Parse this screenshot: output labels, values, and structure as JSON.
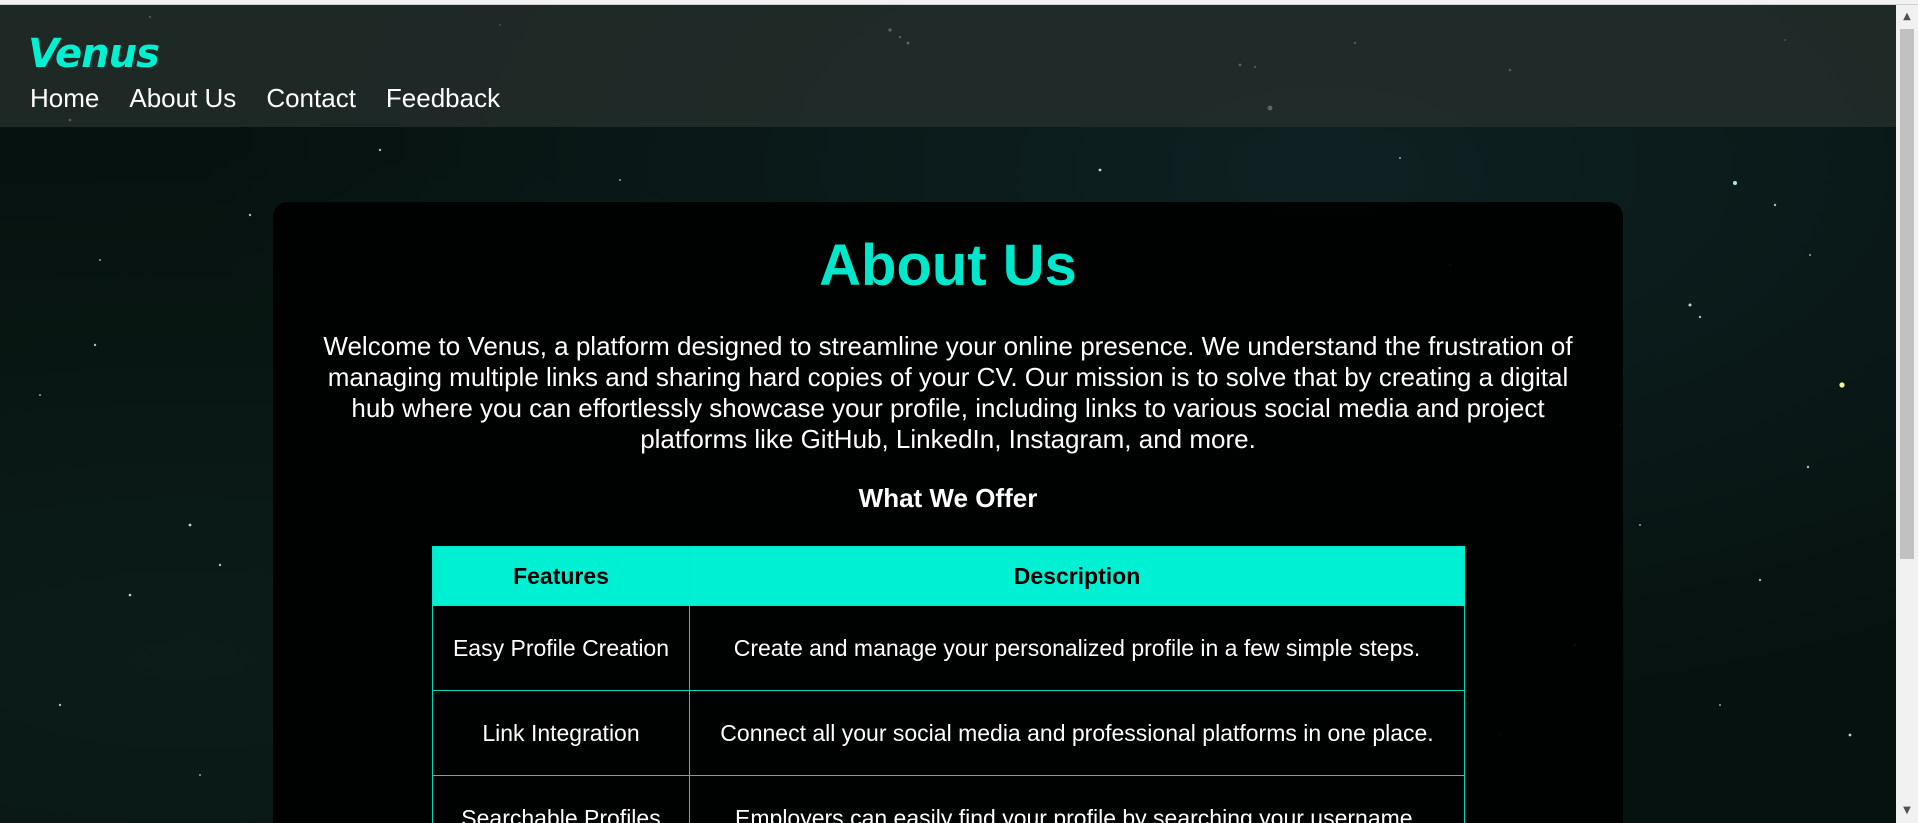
{
  "brand": "Venus",
  "nav": {
    "items": [
      {
        "label": "Home"
      },
      {
        "label": "About Us"
      },
      {
        "label": "Contact"
      },
      {
        "label": "Feedback"
      }
    ]
  },
  "main": {
    "title": "About Us",
    "intro": "Welcome to Venus, a platform designed to streamline your online presence. We understand the frustration of managing multiple links and sharing hard copies of your CV. Our mission is to solve that by creating a digital hub where you can effortlessly showcase your profile, including links to various social media and project platforms like GitHub, LinkedIn, Instagram, and more.",
    "offer_heading": "What We Offer",
    "table": {
      "headers": [
        "Features",
        "Description"
      ],
      "rows": [
        {
          "feature": "Easy Profile Creation",
          "description": "Create and manage your personalized profile in a few simple steps."
        },
        {
          "feature": "Link Integration",
          "description": "Connect all your social media and professional platforms in one place."
        },
        {
          "feature": "Searchable Profiles",
          "description": "Employers can easily find your profile by searching your username."
        }
      ]
    }
  },
  "colors": {
    "accent": "#00f0d4",
    "card_bg": "#000000",
    "text": "#ffffff"
  },
  "icons": [
    "star-background"
  ]
}
